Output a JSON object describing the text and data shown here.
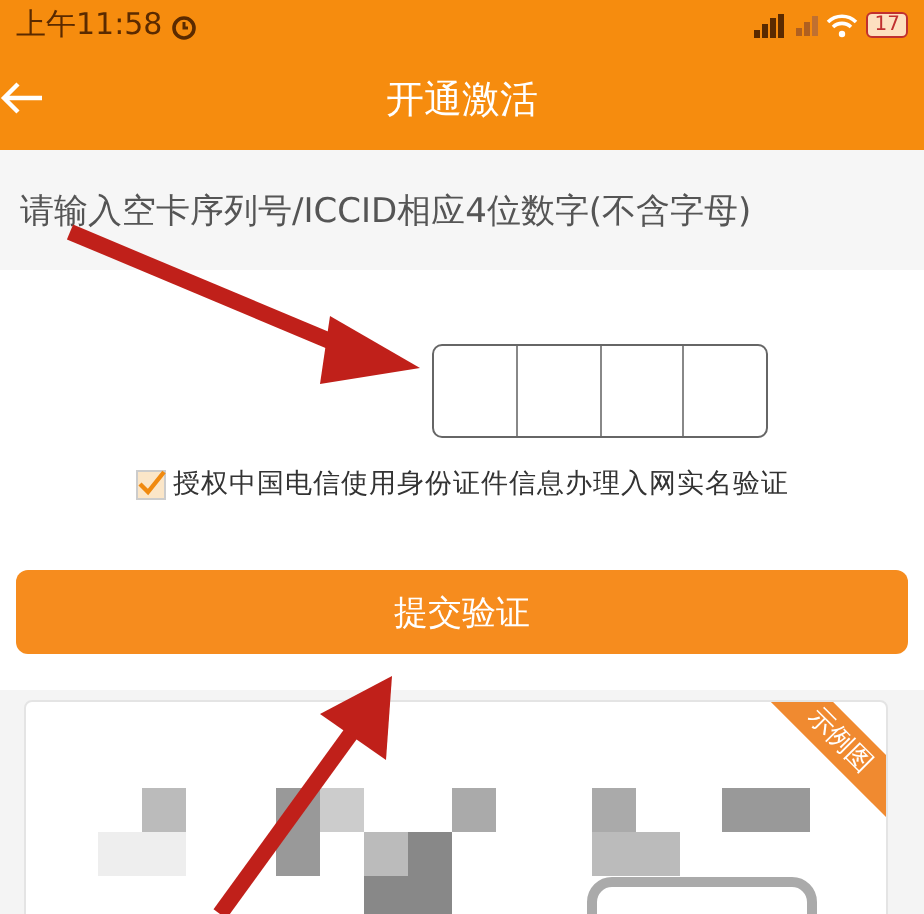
{
  "status_bar": {
    "time": "上午11:58",
    "battery": "17"
  },
  "header": {
    "title": "开通激活"
  },
  "instruction": "请输入空卡序列号/ICCID相应4位数字(不含字母)",
  "agreement": {
    "checked": true,
    "text": "授权中国电信使用身份证件信息办理入网实名验证"
  },
  "submit_button": "提交验证",
  "example": {
    "badge": "示例图"
  }
}
